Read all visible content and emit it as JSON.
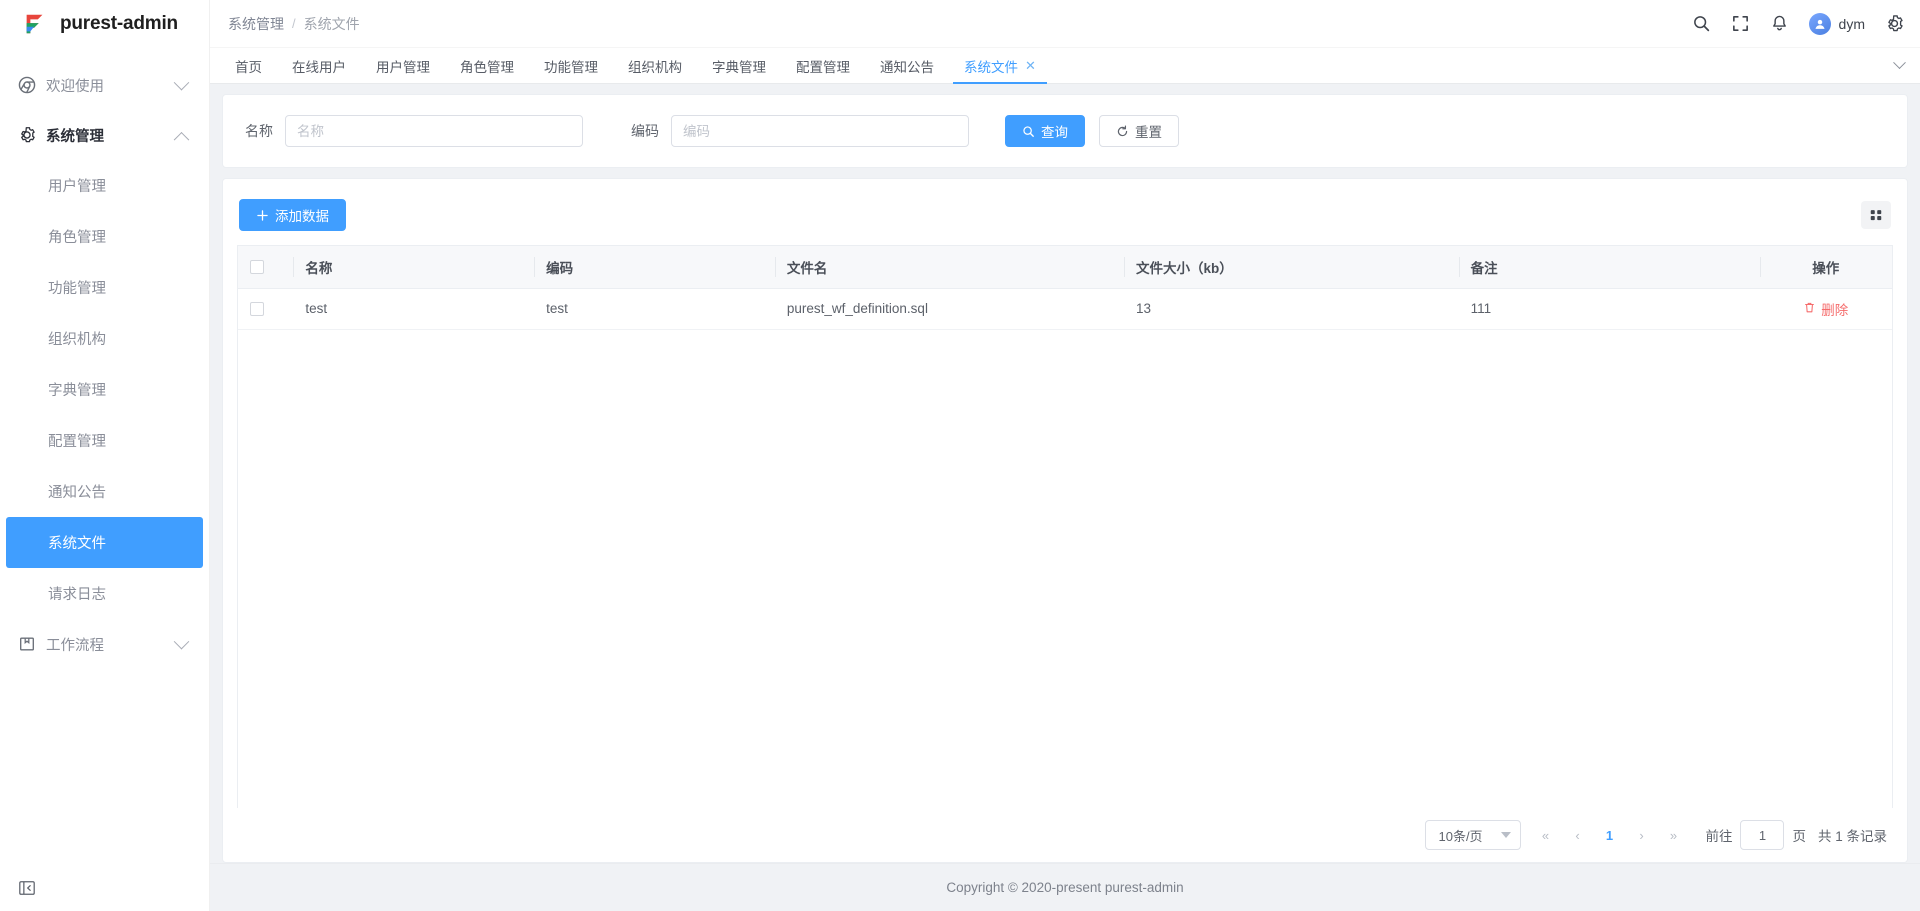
{
  "brand": {
    "name": "purest-admin",
    "logo_icon": "purest-logo-icon"
  },
  "sidebar": {
    "groups": [
      {
        "label": "欢迎使用",
        "icon": "chrome-icon",
        "expanded": false,
        "items": []
      },
      {
        "label": "系统管理",
        "icon": "gear-icon",
        "expanded": true,
        "items": [
          {
            "label": "用户管理",
            "selected": false
          },
          {
            "label": "角色管理",
            "selected": false
          },
          {
            "label": "功能管理",
            "selected": false
          },
          {
            "label": "组织机构",
            "selected": false
          },
          {
            "label": "字典管理",
            "selected": false
          },
          {
            "label": "配置管理",
            "selected": false
          },
          {
            "label": "通知公告",
            "selected": false
          },
          {
            "label": "系统文件",
            "selected": true
          },
          {
            "label": "请求日志",
            "selected": false
          }
        ]
      },
      {
        "label": "工作流程",
        "icon": "book-icon",
        "expanded": false,
        "items": []
      }
    ],
    "collapse_icon": "collapse-sidebar-icon"
  },
  "topbar": {
    "breadcrumb": [
      "系统管理",
      "系统文件"
    ],
    "breadcrumb_separator": "/",
    "icons": [
      "search-icon",
      "fullscreen-icon",
      "bell-icon"
    ],
    "user": {
      "name": "dym",
      "avatar_icon": "avatar-icon"
    },
    "settings_icon": "gear-icon"
  },
  "tabs": {
    "items": [
      {
        "label": "首页",
        "active": false,
        "closable": false
      },
      {
        "label": "在线用户",
        "active": false,
        "closable": false
      },
      {
        "label": "用户管理",
        "active": false,
        "closable": false
      },
      {
        "label": "角色管理",
        "active": false,
        "closable": false
      },
      {
        "label": "功能管理",
        "active": false,
        "closable": false
      },
      {
        "label": "组织机构",
        "active": false,
        "closable": false
      },
      {
        "label": "字典管理",
        "active": false,
        "closable": false
      },
      {
        "label": "配置管理",
        "active": false,
        "closable": false
      },
      {
        "label": "通知公告",
        "active": false,
        "closable": false
      },
      {
        "label": "系统文件",
        "active": true,
        "closable": true,
        "close_glyph": "✕"
      }
    ],
    "more_icon": "chevron-down-icon"
  },
  "search": {
    "name_label": "名称",
    "name_value": "",
    "name_placeholder": "名称",
    "code_label": "编码",
    "code_value": "",
    "code_placeholder": "编码",
    "query_button": "查询",
    "query_icon": "search-icon",
    "reset_button": "重置",
    "reset_icon": "refresh-icon"
  },
  "table": {
    "add_button": "添加数据",
    "add_icon": "plus-icon",
    "grid_icon": "grid-view-icon",
    "columns": [
      "名称",
      "编码",
      "文件名",
      "文件大小（kb）",
      "备注",
      "操作"
    ],
    "rows": [
      {
        "checked": false,
        "name": "test",
        "code": "test",
        "filename": "purest_wf_definition.sql",
        "size": "13",
        "remark": "111",
        "action_label": "删除",
        "action_icon": "trash-icon"
      }
    ]
  },
  "pagination": {
    "page_size_label": "10条/页",
    "first_glyph": "«",
    "prev_glyph": "‹",
    "pages": [
      "1"
    ],
    "current_page": "1",
    "next_glyph": "›",
    "last_glyph": "»",
    "jump_prefix": "前往",
    "jump_value": "1",
    "jump_suffix": "页",
    "total_text": "共 1 条记录"
  },
  "footer": {
    "text": "Copyright © 2020-present purest-admin"
  },
  "colors": {
    "primary": "#409eff",
    "danger": "#f56c6c",
    "sidebar_bg": "#ffffff",
    "page_bg": "#f0f2f5"
  }
}
